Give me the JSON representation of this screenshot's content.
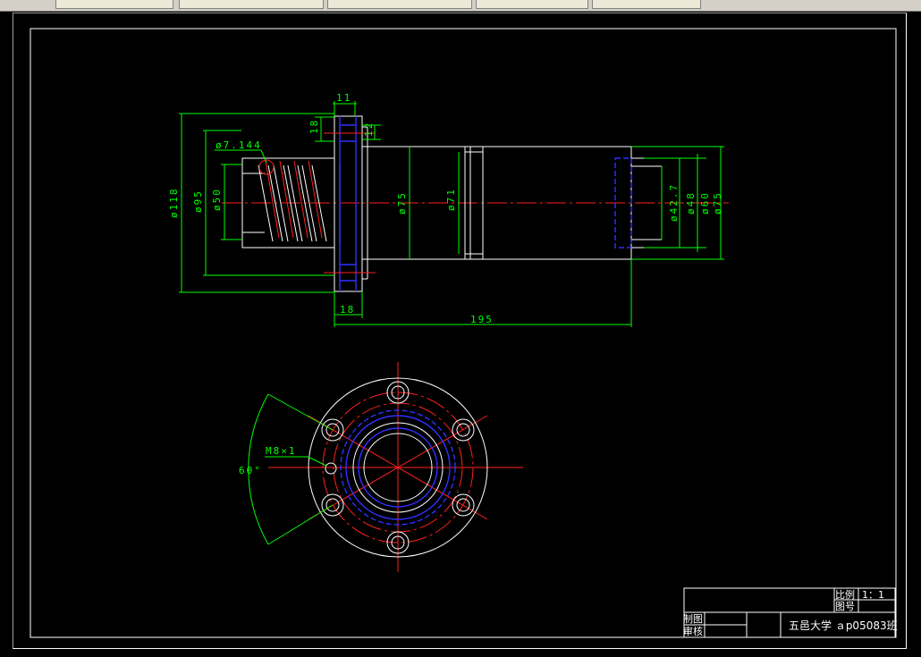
{
  "dimensions": {
    "flange_width": "11",
    "flange_step": "18",
    "flange_small": "12",
    "thread_pitch": "ø7.144",
    "dia_118": "ø118",
    "dia_95": "ø95",
    "dia_50": "ø50",
    "dia_75": "ø75",
    "dia_71": "ø71",
    "dia_42_7": "ø42.7",
    "dia_48": "ø48",
    "dia_60": "ø60",
    "dia_75_right": "ø75",
    "flange_thickness": "18",
    "total_length": "195",
    "bolt_thread": "M8×1",
    "bolt_angle": "60°"
  },
  "title_block": {
    "scale_label": "比例",
    "scale_value": "1：1",
    "drawing_no_label": "图号",
    "drawn_label": "制图",
    "checked_label": "审核",
    "school_class": "五邑大学  ａp05083班"
  },
  "colors": {
    "outline": "#ffffff",
    "dimension": "#00ff00",
    "centerline": "#ff2020",
    "hidden": "#3030ff",
    "background": "#000000"
  }
}
